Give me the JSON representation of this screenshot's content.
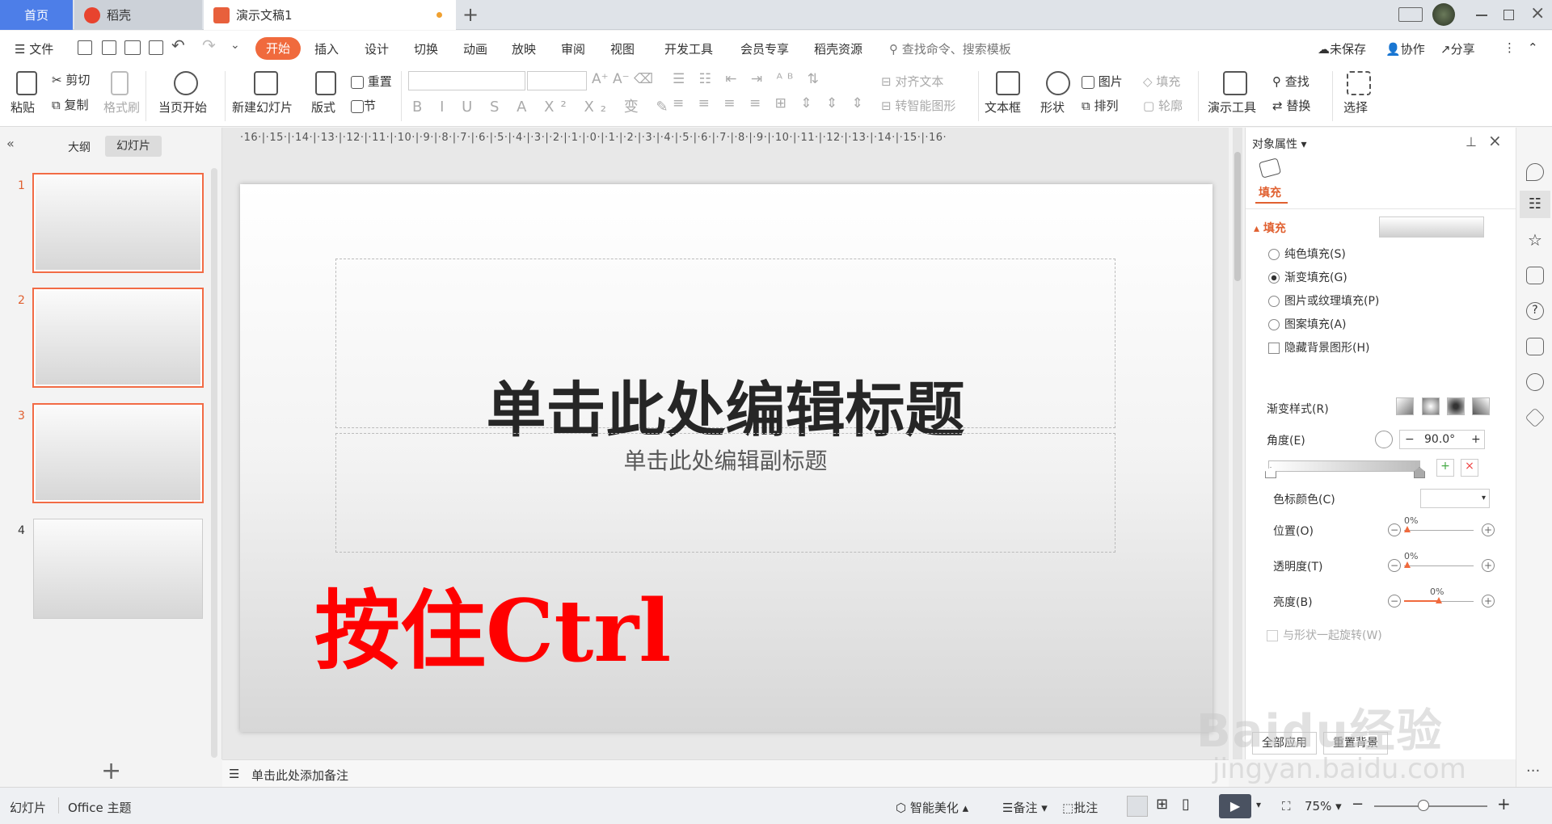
{
  "tabs": {
    "home": "首页",
    "daoke": "稻壳",
    "doc": "演示文稿1"
  },
  "titlebar_colors": {
    "accent": "#4d7ee8",
    "orange": "#f26b45",
    "red": "#ff0000"
  },
  "menu": {
    "file": "文件",
    "items": [
      "开始",
      "插入",
      "设计",
      "切换",
      "动画",
      "放映",
      "审阅",
      "视图",
      "开发工具",
      "会员专享",
      "稻壳资源"
    ],
    "search": "查找命令、搜索模板",
    "unsaved": "未保存",
    "collab": "协作",
    "share": "分享"
  },
  "ribbon": {
    "paste": "粘贴",
    "cut": "剪切",
    "copy": "复制",
    "format_painter": "格式刷",
    "from_current": "当页开始",
    "new_slide": "新建幻灯片",
    "layout": "版式",
    "reset": "重置",
    "section": "节",
    "align_text": "对齐文本",
    "smartart": "转智能图形",
    "textbox": "文本框",
    "shape": "形状",
    "picture": "图片",
    "fill": "填充",
    "arrange": "排列",
    "outline": "轮廓",
    "presentation_tools": "演示工具",
    "find": "查找",
    "replace": "替换",
    "select": "选择"
  },
  "left": {
    "outline": "大纲",
    "slides": "幻灯片",
    "thumbs": [
      "1",
      "2",
      "3",
      "4"
    ]
  },
  "ruler": "·16·|·15·|·14·|·13·|·12·|·11·|·10·|·9·|·8·|·7·|·6·|·5·|·4·|·3·|·2·|·1·|·0·|·1·|·2·|·3·|·4·|·5·|·6·|·7·|·8·|·9·|·10·|·11·|·12·|·13·|·14·|·15·|·16·",
  "slide": {
    "title": "单击此处编辑标题",
    "subtitle": "单击此处编辑副标题",
    "overlay": "按住Ctrl"
  },
  "notes": "单击此处添加备注",
  "props": {
    "header": "对象属性",
    "tab_fill": "填充",
    "section_fill": "填充",
    "opt_solid": "纯色填充(S)",
    "opt_gradient": "渐变填充(G)",
    "opt_picture": "图片或纹理填充(P)",
    "opt_pattern": "图案填充(A)",
    "opt_hide_bg": "隐藏背景图形(H)",
    "gradient_style": "渐变样式(R)",
    "angle": "角度(E)",
    "angle_value": "90.0°",
    "stop_color": "色标颜色(C)",
    "position": "位置(O)",
    "transparency": "透明度(T)",
    "brightness": "亮度(B)",
    "pct_position": "0%",
    "pct_transparency": "0%",
    "pct_brightness": "0%",
    "rotate_with_shape": "与形状一起旋转(W)",
    "apply_all": "全部应用",
    "reset_bg": "重置背景"
  },
  "status": {
    "slide": "幻灯片",
    "theme": "Office 主题",
    "beautify": "智能美化",
    "notes": "备注",
    "comment": "批注",
    "zoom": "75%"
  },
  "watermark": {
    "brand": "Baidu经验",
    "url": "jingyan.baidu.com"
  }
}
